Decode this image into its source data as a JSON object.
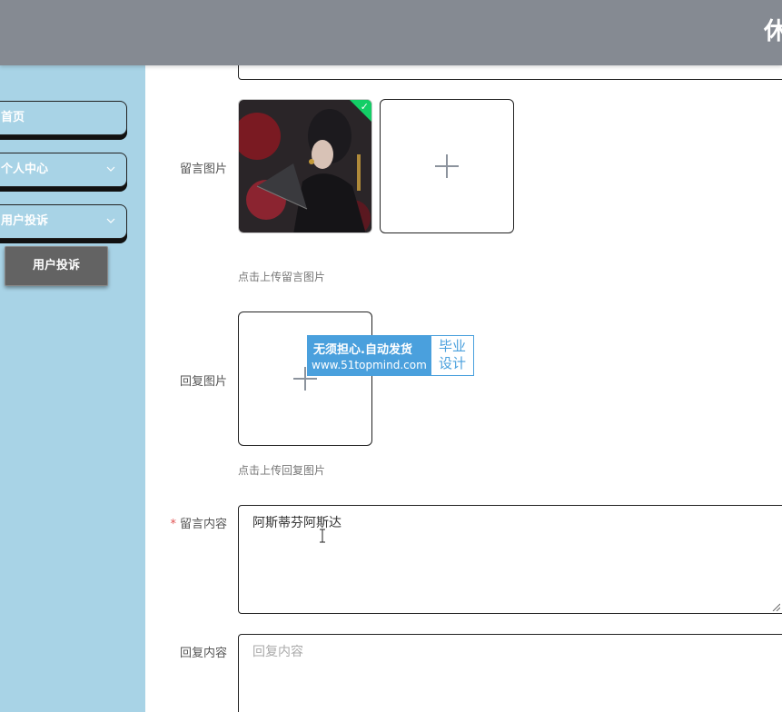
{
  "header": {
    "title": "休"
  },
  "sidebar": {
    "items": [
      {
        "label": "首页"
      },
      {
        "label": "个人中心"
      },
      {
        "label": "用户投诉"
      }
    ],
    "subitems": [
      {
        "label": "用户投诉"
      }
    ]
  },
  "form": {
    "message_image": {
      "label": "留言图片",
      "hint": "点击上传留言图片"
    },
    "reply_image": {
      "label": "回复图片",
      "hint": "点击上传回复图片"
    },
    "message_content": {
      "label": "留言内容",
      "required_mark": "*",
      "value": "阿斯蒂芬阿斯达"
    },
    "reply_content": {
      "label": "回复内容",
      "placeholder": "回复内容"
    }
  },
  "watermark": {
    "line1": "无须担心.自动发货",
    "line2": "www.51topmind.com",
    "badge_line1": "毕业",
    "badge_line2": "设计"
  },
  "colors": {
    "header_bg": "#858a92",
    "sidebar_bg": "#a8d3e6",
    "submenu_bg": "#636363",
    "success_badge": "#13ce66",
    "watermark_blue": "#4aa0dd"
  }
}
